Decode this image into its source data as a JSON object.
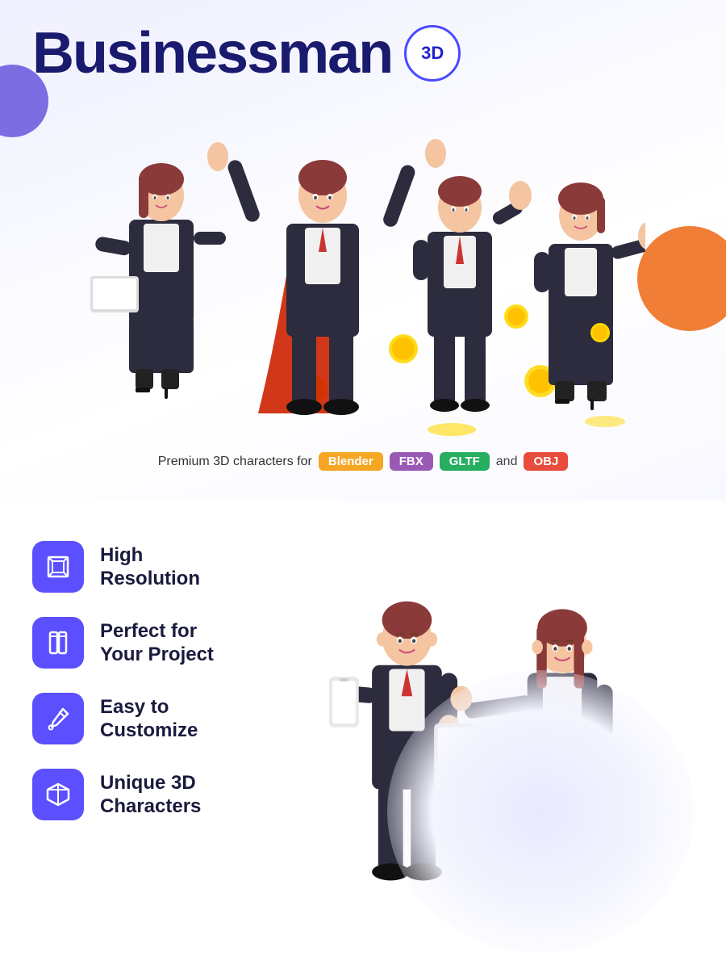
{
  "header": {
    "title": "Businessman",
    "badge": "3D"
  },
  "subtitle": {
    "text": "Premium 3D characters for",
    "formats": [
      "Blender",
      "FBX",
      "GLTF",
      "and",
      "OBJ"
    ]
  },
  "features": [
    {
      "id": "high-resolution",
      "icon": "resize-icon",
      "title_line1": "High",
      "title_line2": "Resolution"
    },
    {
      "id": "perfect-for",
      "icon": "phone-icon",
      "title_line1": "Perfect for",
      "title_line2": "Your Project"
    },
    {
      "id": "easy-to-customize",
      "icon": "eyedropper-icon",
      "title_line1": "Easy to",
      "title_line2": "Customize"
    },
    {
      "id": "unique-characters",
      "icon": "box-icon",
      "title_line1": "Unique 3D",
      "title_line2": "Characters"
    }
  ],
  "colors": {
    "title": "#1a1a6e",
    "badge_border": "#4a4aff",
    "feature_icon_bg": "#5b4fff",
    "blender": "#f5a623",
    "fbx": "#9b59b6",
    "gltf": "#27ae60",
    "obj": "#e74c3c"
  }
}
